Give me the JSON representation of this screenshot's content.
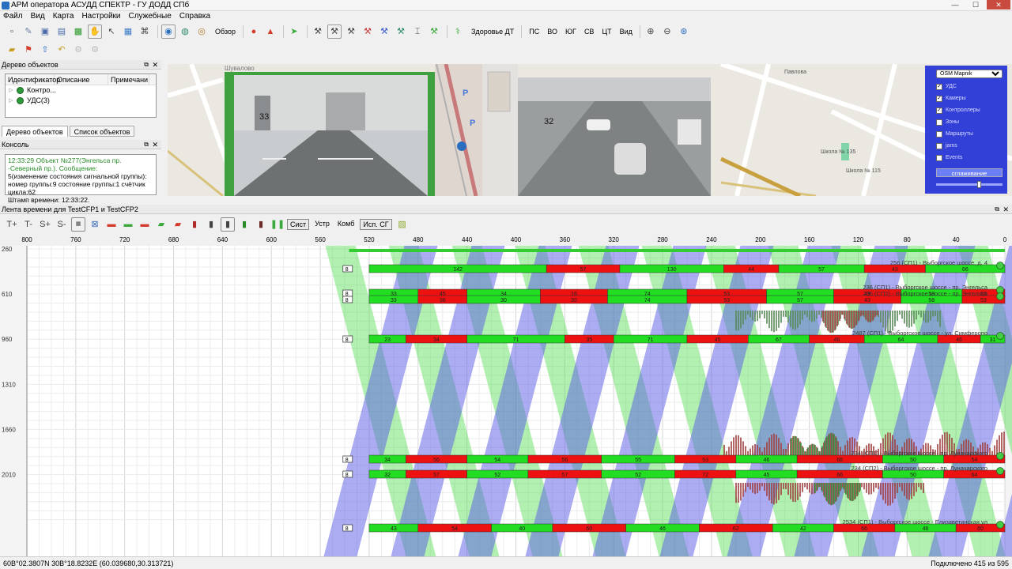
{
  "window": {
    "title": "АРМ оператора АСУДД СПЕКТР - ГУ ДОДД СПб"
  },
  "menu": [
    "Файл",
    "Вид",
    "Карта",
    "Настройки",
    "Служебные",
    "Справка"
  ],
  "toolbar": {
    "overview_label": "Обзор",
    "health_label": "Здоровье ДТ",
    "days": [
      "ПС",
      "ВО",
      "ЮГ",
      "СВ",
      "ЦТ",
      "Вид"
    ]
  },
  "object_tree": {
    "title": "Дерево объектов",
    "columns": [
      "Идентификатор",
      "Описание",
      "Примечани"
    ],
    "rows": [
      "Контро...",
      "УДС(3)"
    ],
    "tabs": [
      "Дерево объектов",
      "Список объектов"
    ]
  },
  "console": {
    "title": "Консоль",
    "line1": "12:33:29 Объект №277(Энгельса пр. -Северный пр.). Сообщение:",
    "line2": "5(изменение состояния сигнальной группы): номер группы:9 состояние группы:1 счётчик цикла:62",
    "line3": "Штамп времени: 12:33:22."
  },
  "map": {
    "street": "Шувалово",
    "cam1_number": "33",
    "cam2_number": "32",
    "school1": "Школа № 135",
    "school2": "Школа № 115",
    "pavlova": "Павлова"
  },
  "layers": {
    "source": "OSM Mapnik",
    "items": [
      {
        "label": "УДС",
        "checked": true
      },
      {
        "label": "Камеры",
        "checked": true
      },
      {
        "label": "Контроллеры",
        "checked": true
      },
      {
        "label": "Зоны",
        "checked": false
      },
      {
        "label": "Маршруты",
        "checked": false
      },
      {
        "label": "jams",
        "checked": false
      },
      {
        "label": "Events",
        "checked": false
      }
    ],
    "smooth_label": "сглаживание"
  },
  "timeline": {
    "title": "Лента времени для TestCFP1 и TestCFP2",
    "buttons": [
      "Сист",
      "Устр",
      "Комб",
      "Исп. СГ"
    ],
    "x_ticks": [
      "800",
      "760",
      "720",
      "680",
      "640",
      "600",
      "560",
      "520",
      "480",
      "440",
      "400",
      "360",
      "320",
      "280",
      "240",
      "200",
      "160",
      "120",
      "80",
      "40",
      "0"
    ],
    "y_ticks": [
      "260",
      "610",
      "960",
      "1310",
      "1660",
      "2010"
    ]
  },
  "chart_data": {
    "type": "bar",
    "xlabel": "",
    "ylabel": "",
    "xlim": [
      800,
      0
    ],
    "ylim": [
      260,
      2360
    ],
    "rows": [
      {
        "label": "256 (СП1) - Выборгское шоссе, д. 4",
        "segments": [
          [
            520,
            "142"
          ],
          [
            375,
            "57"
          ],
          [
            315,
            "130"
          ],
          [
            230,
            "44"
          ],
          [
            185,
            "57"
          ],
          [
            115,
            "43"
          ],
          [
            65,
            "66"
          ]
        ]
      },
      {
        "label": "236 (СП1) - Выборгское шоссе - пр. Энгельса",
        "segments": [
          [
            520,
            "33"
          ],
          [
            480,
            "45"
          ],
          [
            440,
            "34"
          ],
          [
            380,
            "16"
          ],
          [
            325,
            "74"
          ],
          [
            260,
            "53"
          ],
          [
            195,
            "57"
          ],
          [
            140,
            "43"
          ],
          [
            85,
            "58"
          ],
          [
            35,
            "53"
          ]
        ]
      },
      {
        "label": "236 (СП2) - Выборгское шоссе - пр. Энгельса",
        "segments": [
          [
            520,
            "33"
          ],
          [
            480,
            "36"
          ],
          [
            440,
            "30"
          ],
          [
            380,
            "30"
          ],
          [
            325,
            "74"
          ],
          [
            260,
            "53"
          ],
          [
            195,
            "57"
          ],
          [
            140,
            "43"
          ],
          [
            85,
            "58"
          ],
          [
            35,
            "53"
          ]
        ]
      },
      {
        "label": "2487 (СП1) - Выборгское шоссе - ул. Симферопо",
        "segments": [
          [
            520,
            "23"
          ],
          [
            490,
            "34"
          ],
          [
            440,
            "71"
          ],
          [
            360,
            "35"
          ],
          [
            320,
            "71"
          ],
          [
            260,
            "45"
          ],
          [
            210,
            "67"
          ],
          [
            160,
            "46"
          ],
          [
            115,
            "64"
          ],
          [
            55,
            "46"
          ],
          [
            20,
            "31"
          ]
        ]
      },
      {
        "label": "234 (СП1) - Выборгское шоссе - пр. Луначарского",
        "segments": [
          [
            520,
            "34"
          ],
          [
            490,
            "56"
          ],
          [
            440,
            "54"
          ],
          [
            390,
            "56"
          ],
          [
            330,
            "55"
          ],
          [
            270,
            "53"
          ],
          [
            220,
            "46"
          ],
          [
            170,
            "66"
          ],
          [
            100,
            "50"
          ],
          [
            50,
            "54"
          ]
        ]
      },
      {
        "label": "234 (СП2) - Выборгское шоссе - пр. Луначарского",
        "segments": [
          [
            520,
            "32"
          ],
          [
            490,
            "57"
          ],
          [
            440,
            "52"
          ],
          [
            390,
            "57"
          ],
          [
            330,
            "52"
          ],
          [
            270,
            "72"
          ],
          [
            220,
            "45"
          ],
          [
            170,
            "66"
          ],
          [
            100,
            "50"
          ],
          [
            50,
            "64"
          ]
        ]
      },
      {
        "label": "2534 (СП1) - Выборгское шоссе - Елизаветинская ул",
        "segments": [
          [
            520,
            "43"
          ],
          [
            480,
            "54"
          ],
          [
            420,
            "40"
          ],
          [
            370,
            "60"
          ],
          [
            310,
            "46"
          ],
          [
            250,
            "62"
          ],
          [
            190,
            "42"
          ],
          [
            140,
            "66"
          ],
          [
            90,
            "46"
          ],
          [
            40,
            "60"
          ]
        ]
      }
    ]
  },
  "status": {
    "coords": "60В°02.3807N 30В°18.8232E (60.039680,30.313721)",
    "connected": "Подключено 415 из 595"
  }
}
